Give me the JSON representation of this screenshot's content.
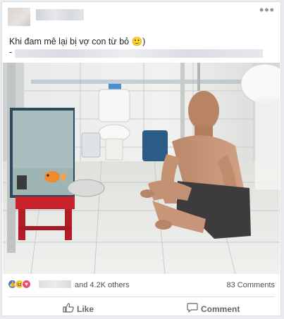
{
  "post": {
    "caption": "Khi đam mê lại bị vợ con từ bỏ 🙂)",
    "caption_line2_prefix": "-",
    "more_icon": "more-horizontal-icon"
  },
  "reactions": {
    "icons": [
      "like-icon",
      "haha-icon",
      "love-icon"
    ],
    "likes_text": "and 4.2K others",
    "comments_text": "83 Comments"
  },
  "actions": {
    "like_label": "Like",
    "comment_label": "Comment"
  },
  "colors": {
    "like_blue": "#3b78e7",
    "love_red": "#ef4d6c",
    "haha_yellow": "#f7c942",
    "muted_text": "#606770"
  }
}
